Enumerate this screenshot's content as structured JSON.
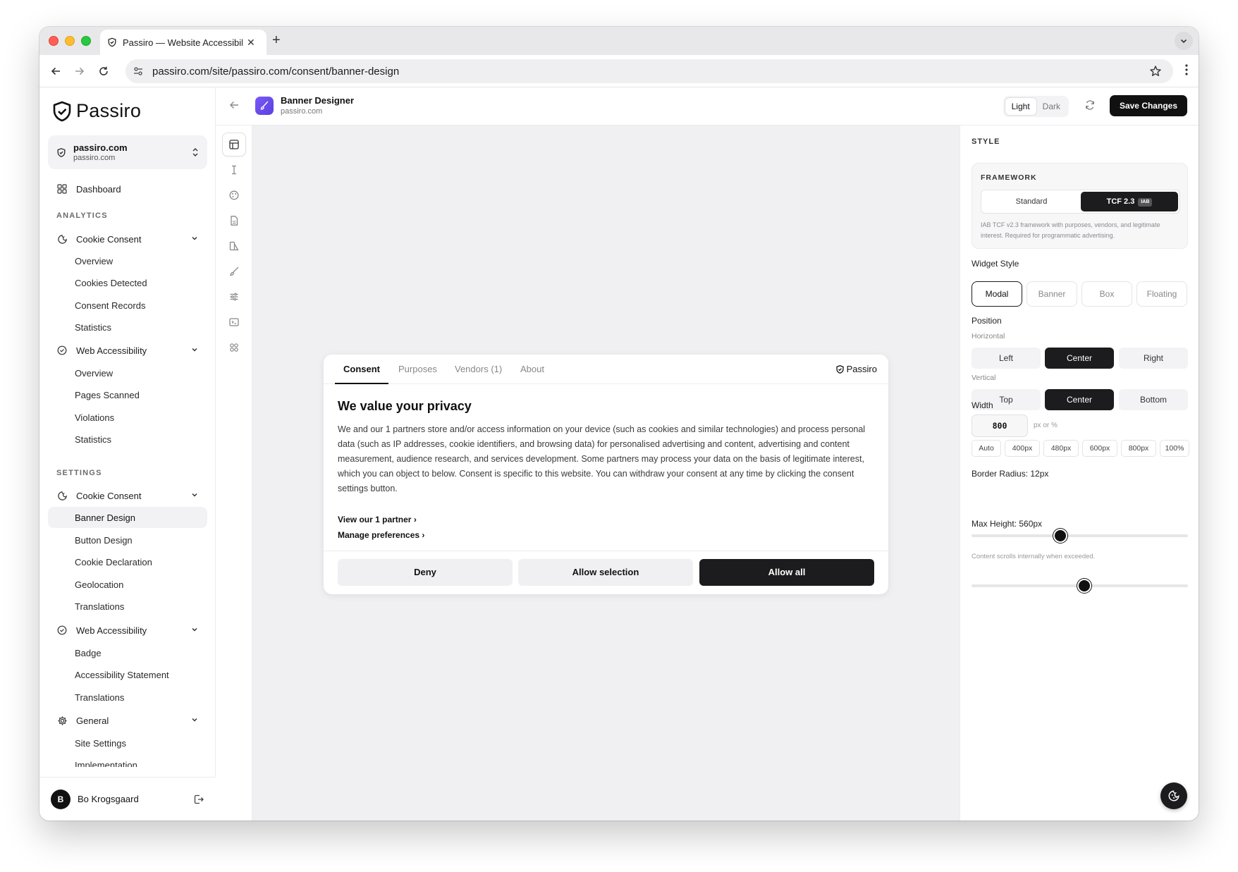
{
  "browser": {
    "tab_title": "Passiro — Website Accessibili",
    "url": "passiro.com/site/passiro.com/consent/banner-design"
  },
  "sidebar": {
    "brand": "Passiro",
    "site": {
      "name": "passiro.com",
      "domain": "passiro.com"
    },
    "dashboard": "Dashboard",
    "analytics_label": "ANALYTICS",
    "analytics": {
      "cookie_consent": "Cookie Consent",
      "cookie_items": [
        "Overview",
        "Cookies Detected",
        "Consent Records",
        "Statistics"
      ],
      "web_accessibility": "Web Accessibility",
      "wa_items": [
        "Overview",
        "Pages Scanned",
        "Violations",
        "Statistics"
      ]
    },
    "settings_label": "SETTINGS",
    "settings": {
      "cookie_consent": "Cookie Consent",
      "cookie_items": [
        "Banner Design",
        "Button Design",
        "Cookie Declaration",
        "Geolocation",
        "Translations"
      ],
      "web_accessibility": "Web Accessibility",
      "wa_items": [
        "Badge",
        "Accessibility Statement",
        "Translations"
      ],
      "general": "General",
      "general_items": [
        "Site Settings",
        "Implementation"
      ]
    },
    "user": {
      "initial": "B",
      "name": "Bo Krogsgaard"
    }
  },
  "header": {
    "title": "Banner Designer",
    "subtitle": "passiro.com",
    "theme_light": "Light",
    "theme_dark": "Dark",
    "save_label": "Save Changes"
  },
  "banner": {
    "tabs": [
      "Consent",
      "Purposes",
      "Vendors (1)",
      "About"
    ],
    "brand": "Passiro",
    "heading": "We value your privacy",
    "body": "We and our 1 partners store and/or access information on your device (such as cookies and similar technologies) and process personal data (such as IP addresses, cookie identifiers, and browsing data) for personalised advertising and content, advertising and content measurement, audience research, and services development. Some partners may process your data on the basis of legitimate interest, which you can object to below. Consent is specific to this website. You can withdraw your consent at any time by clicking the consent settings button.",
    "link_partners": "View our 1 partner ›",
    "link_manage": "Manage preferences ›",
    "deny": "Deny",
    "allow_selection": "Allow selection",
    "allow_all": "Allow all"
  },
  "panel": {
    "style_label": "STYLE",
    "framework_label": "FRAMEWORK",
    "framework_standard": "Standard",
    "framework_tcf": "TCF 2.3",
    "framework_badge": "IAB",
    "framework_desc": "IAB TCF v2.3 framework with purposes, vendors, and legitimate interest. Required for programmatic advertising.",
    "widget_style_label": "Widget Style",
    "widget_styles": [
      "Modal",
      "Banner",
      "Box",
      "Floating"
    ],
    "position_label": "Position",
    "horizontal_label": "Horizontal",
    "horizontal": [
      "Left",
      "Center",
      "Right"
    ],
    "vertical_label": "Vertical",
    "vertical": [
      "Top",
      "Center",
      "Bottom"
    ],
    "width_label": "Width",
    "width_value": "800",
    "width_unit": "px or %",
    "width_presets": [
      "Auto",
      "400px",
      "480px",
      "600px",
      "800px",
      "100%"
    ],
    "border_radius_label": "Border Radius: 12px",
    "border_radius_fraction": 0.41,
    "max_height_label": "Max Height: 560px",
    "max_height_fraction": 0.52,
    "max_height_hint": "Content scrolls internally when exceeded."
  }
}
